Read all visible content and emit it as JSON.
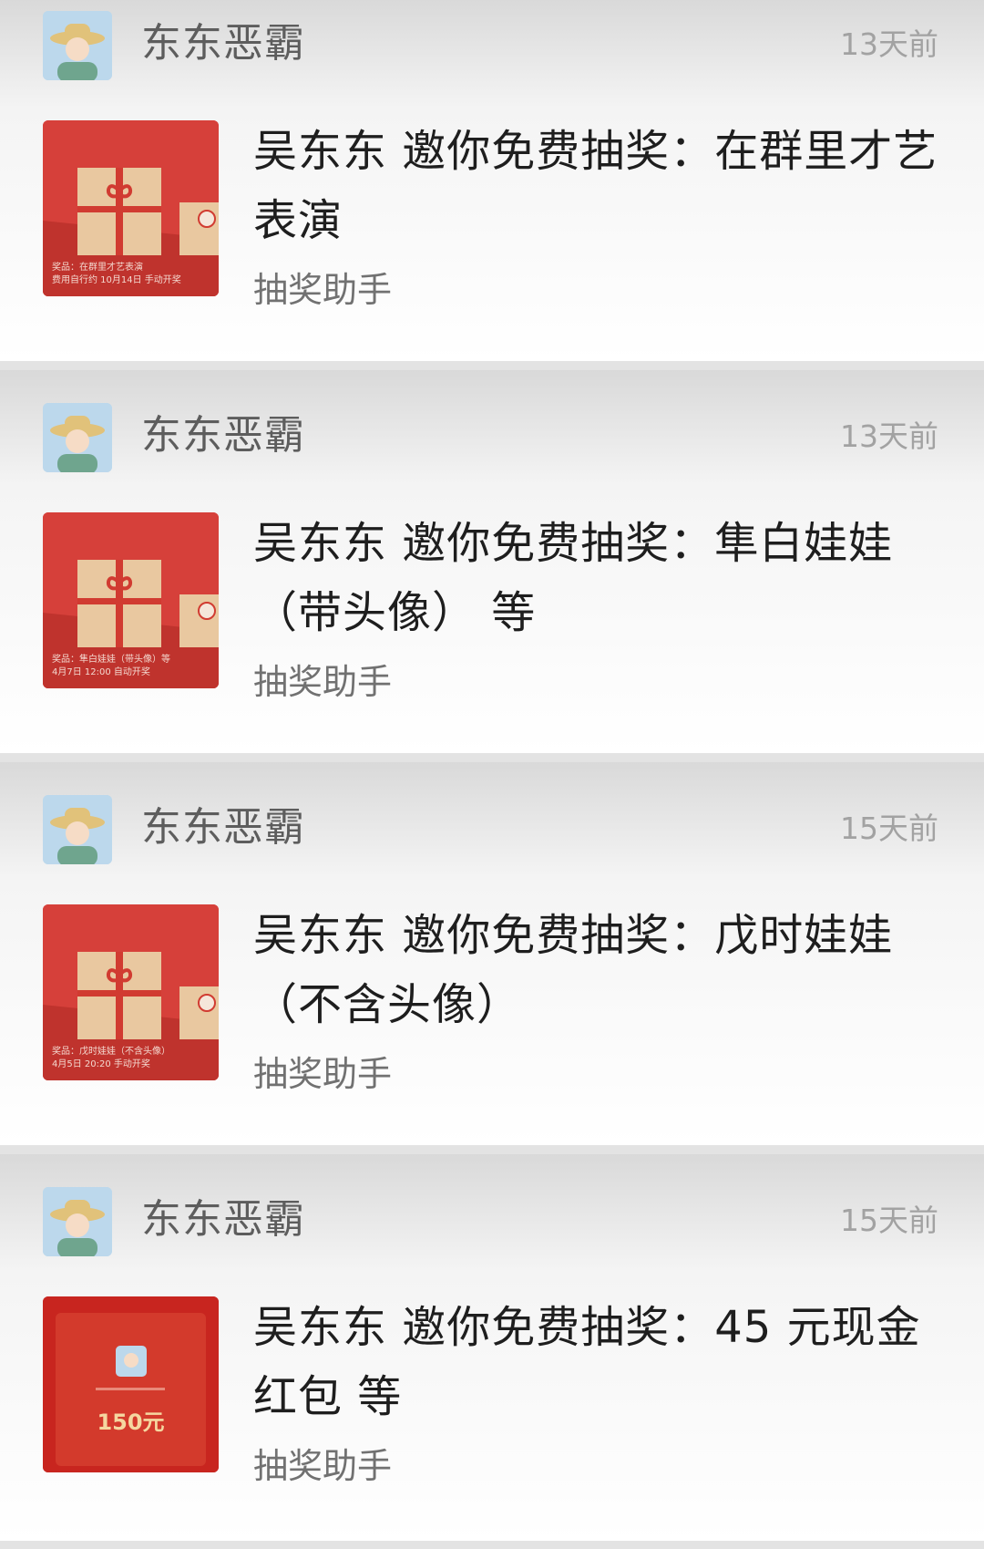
{
  "messages": [
    {
      "sender": "东东恶霸",
      "time": "13天前",
      "title": "吴东东 邀你免费抽奖：在群里才艺表演",
      "source": "抽奖助手",
      "thumb_type": "gift-box",
      "thumb_caption": [
        "奖品：在群里才艺表演",
        "费用自行约 10月14日 手动开奖"
      ]
    },
    {
      "sender": "东东恶霸",
      "time": "13天前",
      "title": "吴东东 邀你免费抽奖：隼白娃娃（带头像） 等",
      "source": "抽奖助手",
      "thumb_type": "gift-box",
      "thumb_caption": [
        "奖品：隼白娃娃（带头像）等",
        "4月7日 12:00 自动开奖"
      ]
    },
    {
      "sender": "东东恶霸",
      "time": "15天前",
      "title": "吴东东 邀你免费抽奖：戊时娃娃（不含头像）",
      "source": "抽奖助手",
      "thumb_type": "gift-box",
      "thumb_caption": [
        "奖品：戊时娃娃（不含头像）",
        "4月5日 20:20 手动开奖"
      ]
    },
    {
      "sender": "东东恶霸",
      "time": "15天前",
      "title": "吴东东 邀你免费抽奖：45 元现金红包 等",
      "source": "抽奖助手",
      "thumb_type": "red-packet",
      "thumb_amount": "150元"
    }
  ],
  "colors": {
    "thumb_red": "#d6403a",
    "packet_red": "#c8251f",
    "gift_box": "#e9c8a0",
    "ribbon": "#d13b31"
  }
}
